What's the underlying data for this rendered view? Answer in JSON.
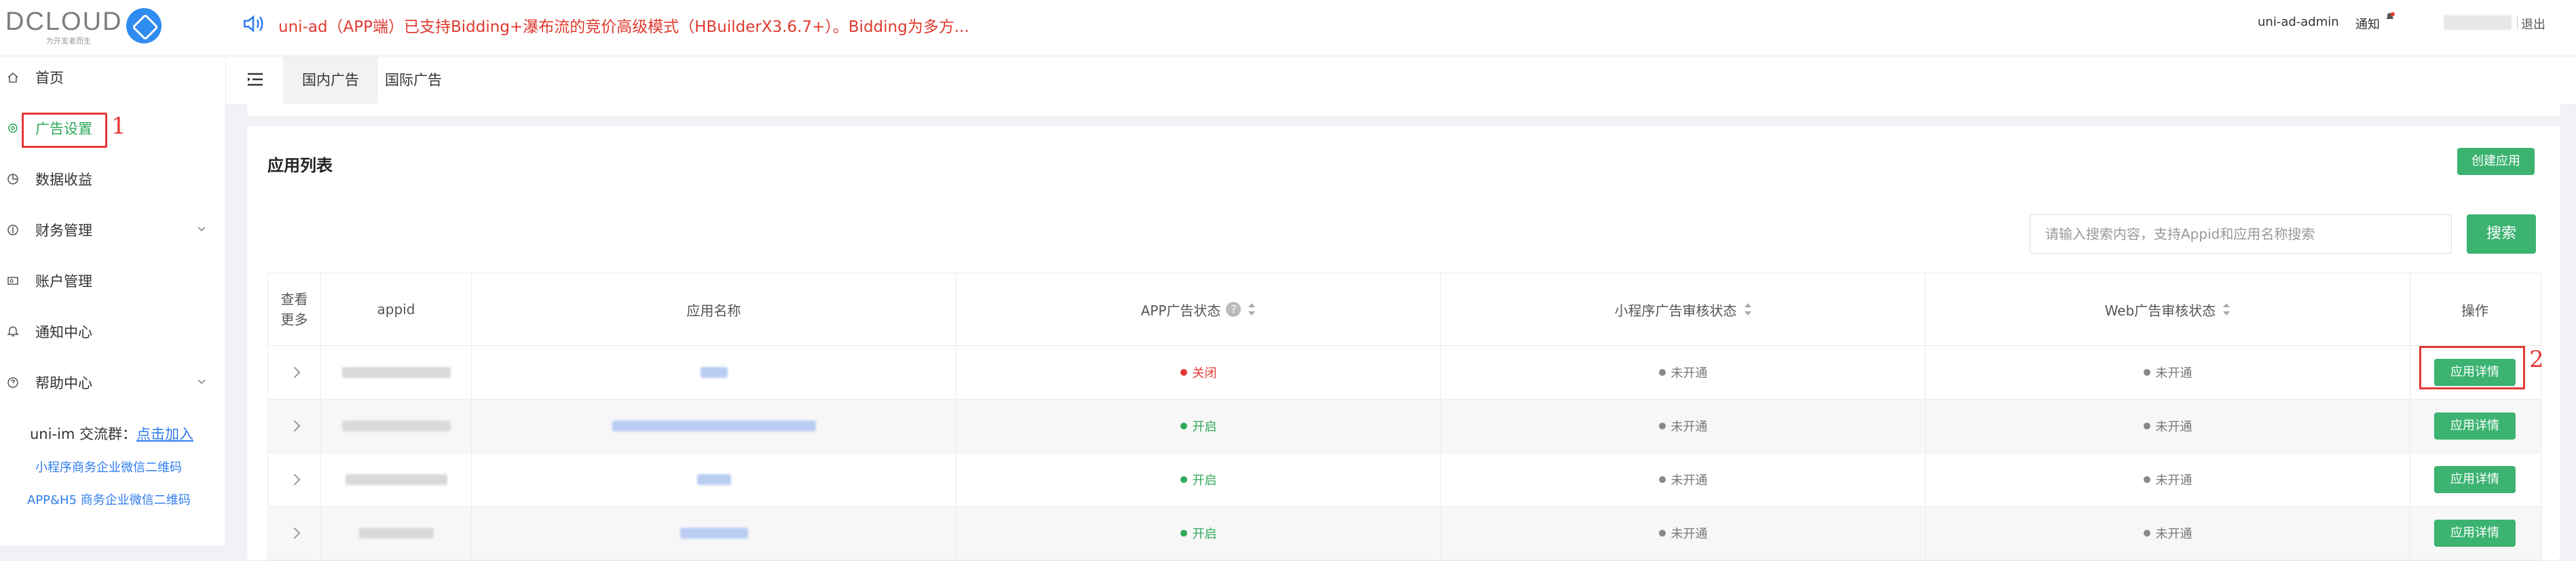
{
  "header": {
    "brand": "DCLOUD",
    "slogan": "为开发者而生",
    "notice": "uni-ad（APP端）已支持Bidding+瀑布流的竞价高级模式（HBuilderX3.6.7+）。Bidding为多方...",
    "user": "uni-ad-admin",
    "notify_label": "通知",
    "logout_label": "退出"
  },
  "sidebar": {
    "items": [
      {
        "label": "首页",
        "icon": "home-icon"
      },
      {
        "label": "广告设置",
        "icon": "gear-icon"
      },
      {
        "label": "数据收益",
        "icon": "chart-icon"
      },
      {
        "label": "财务管理",
        "icon": "finance-icon"
      },
      {
        "label": "账户管理",
        "icon": "account-icon"
      },
      {
        "label": "通知中心",
        "icon": "bell-icon"
      },
      {
        "label": "帮助中心",
        "icon": "help-icon"
      }
    ],
    "group_prefix": "uni-im 交流群：",
    "group_link": "点击加入",
    "link1": "小程序商务企业微信二维码",
    "link2": "APP&H5 商务企业微信二维码",
    "annotation": "1"
  },
  "tabs": [
    {
      "label": "国内广告"
    },
    {
      "label": "国际广告"
    }
  ],
  "card": {
    "title": "应用列表",
    "create_label": "创建应用",
    "search_placeholder": "请输入搜索内容，支持Appid和应用名称搜索",
    "search_label": "搜索"
  },
  "table": {
    "headers": {
      "more": "查看更多",
      "appid": "appid",
      "name": "应用名称",
      "app_status": "APP广告状态",
      "mp_status": "小程序广告审核状态",
      "web_status": "Web广告审核状态",
      "ops": "操作"
    },
    "rows": [
      {
        "app_status": "关闭",
        "mp_status": "未开通",
        "web_status": "未开通",
        "action": "应用详情"
      },
      {
        "app_status": "开启",
        "mp_status": "未开通",
        "web_status": "未开通",
        "action": "应用详情"
      },
      {
        "app_status": "开启",
        "mp_status": "未开通",
        "web_status": "未开通",
        "action": "应用详情"
      },
      {
        "app_status": "开启",
        "mp_status": "未开通",
        "web_status": "未开通",
        "action": "应用详情"
      }
    ],
    "annotation": "2"
  },
  "colors": {
    "accent": "#3cb371",
    "off": "#e53935",
    "on": "#2faa58",
    "notice": "#e03a2f"
  }
}
